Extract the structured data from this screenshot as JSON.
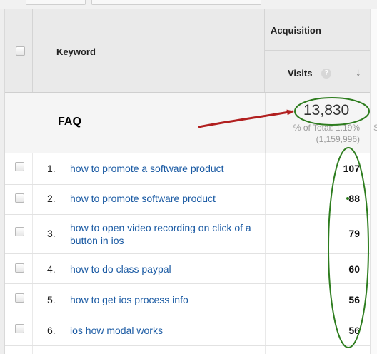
{
  "header": {
    "keyword_label": "Keyword",
    "acquisition_label": "Acquisition",
    "visits_label": "Visits",
    "help_icon_glyph": "?",
    "sort_icon_glyph": "↓"
  },
  "summary": {
    "label": "FAQ",
    "visits_total": "13,830",
    "percent_line": "% of Total: 1.19%",
    "total_line": "(1,159,996)",
    "right_clipped": "S"
  },
  "rows": [
    {
      "index": "1.",
      "keyword": "how to promote a software product",
      "visits": "107"
    },
    {
      "index": "2.",
      "keyword": "how to promote software product",
      "visits": "88"
    },
    {
      "index": "3.",
      "keyword": "how to open video recording on click of a button in ios",
      "visits": "79"
    },
    {
      "index": "4.",
      "keyword": "how to do class paypal",
      "visits": "60"
    },
    {
      "index": "5.",
      "keyword": "how to get ios process info",
      "visits": "56"
    },
    {
      "index": "6.",
      "keyword": "ios how modal works",
      "visits": "56"
    }
  ],
  "annotations": {
    "circle_color": "#2e7d1f",
    "arrow_color": "#b11f1f"
  }
}
